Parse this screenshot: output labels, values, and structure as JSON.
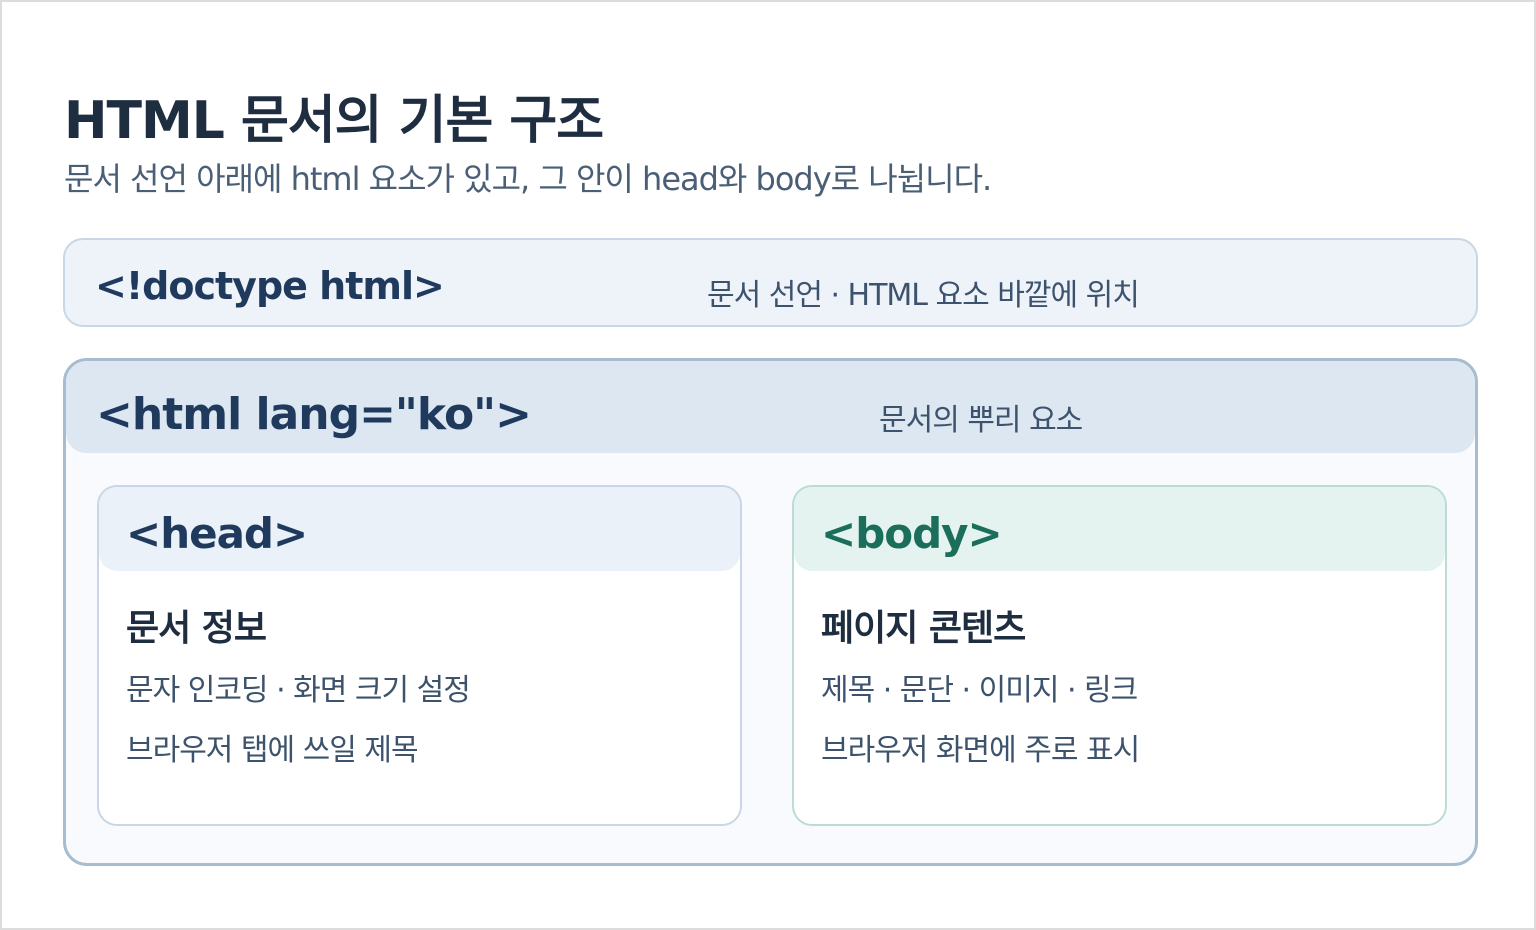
{
  "title": "HTML 문서의 기본 구조",
  "subtitle": "문서 선언 아래에 html 요소가 있고, 그 안이 head와 body로 나뉩니다.",
  "doctype": {
    "code": "<!doctype html>",
    "description": "문서 선언 · HTML 요소 바깥에 위치"
  },
  "html_element": {
    "code": "<html lang=\"ko\">",
    "description": "문서의 뿌리 요소"
  },
  "head": {
    "code": "<head>",
    "title": "문서 정보",
    "lines": [
      "문자 인코딩 · 화면 크기 설정",
      "브라우저 탭에 쓰일 제목"
    ]
  },
  "body": {
    "code": "<body>",
    "title": "페이지 콘텐츠",
    "lines": [
      "제목 · 문단 · 이미지 · 링크",
      "브라우저 화면에 주로 표시"
    ]
  },
  "colors": {
    "title_text": "#1f2d40",
    "head_accent": "#1f3a5c",
    "body_accent": "#1a6e5a"
  }
}
